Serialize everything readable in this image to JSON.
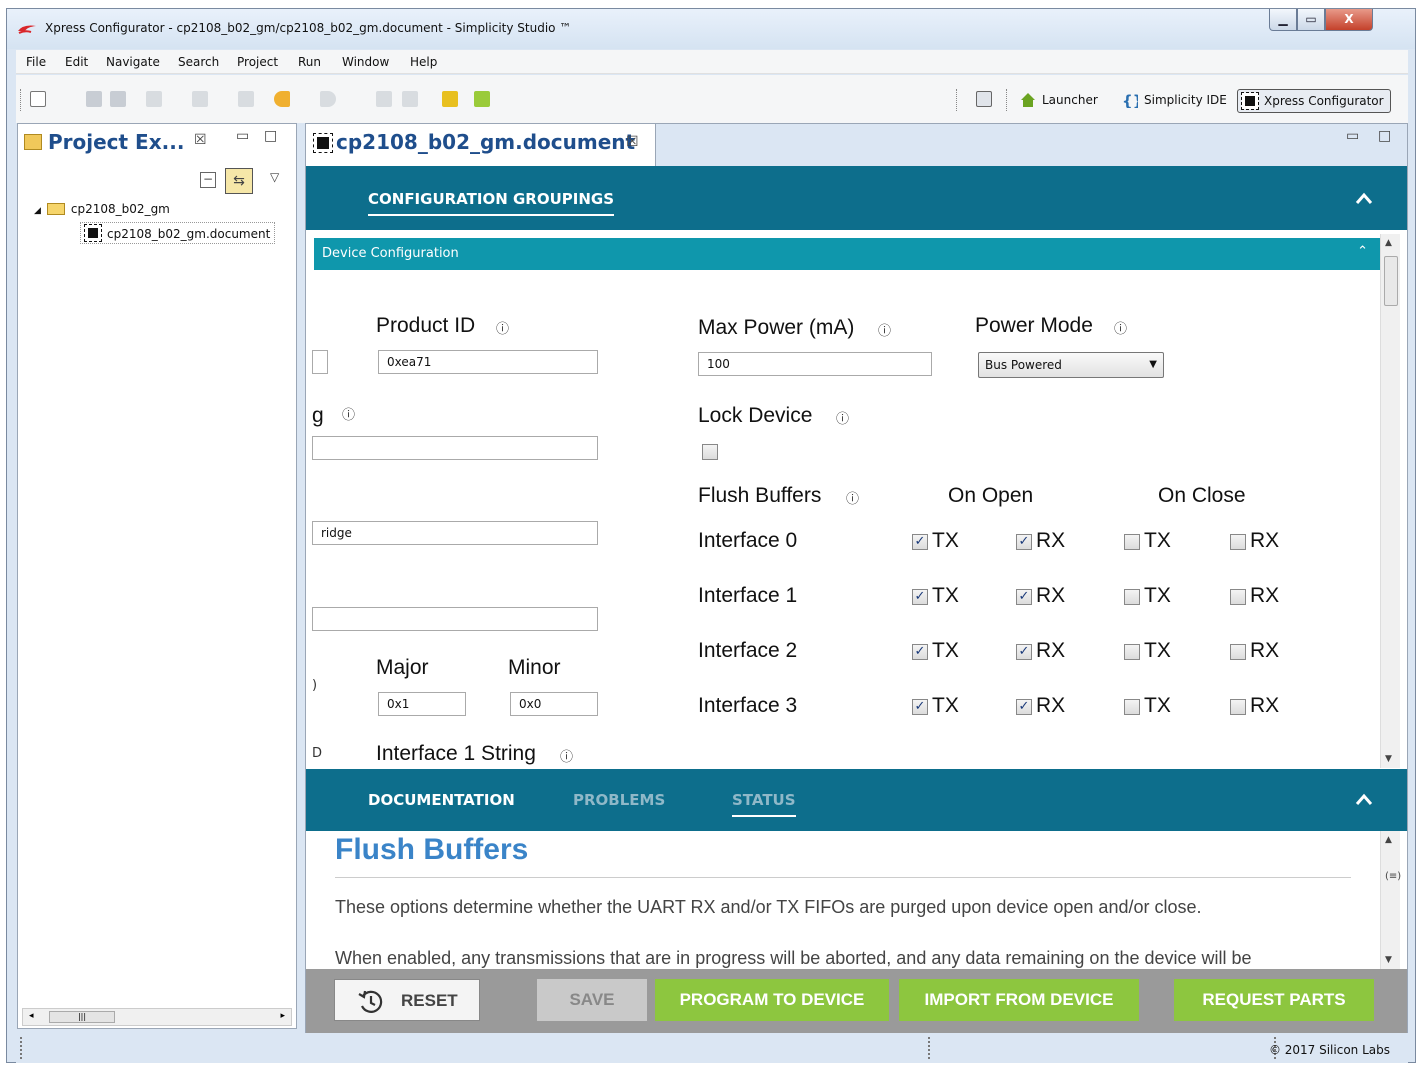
{
  "window": {
    "title": "Xpress Configurator - cp2108_b02_gm/cp2108_b02_gm.document - Simplicity Studio ™",
    "close_glyph": "X"
  },
  "menu": [
    "File",
    "Edit",
    "Navigate",
    "Search",
    "Project",
    "Run",
    "Window",
    "Help"
  ],
  "perspectives": {
    "launcher": "Launcher",
    "ide": "Simplicity IDE",
    "configurator": "Xpress Configurator"
  },
  "project_explorer": {
    "title": "Project Ex...",
    "tree": [
      {
        "label": "cp2108_b02_gm",
        "type": "folder"
      },
      {
        "label": "cp2108_b02_gm.document",
        "type": "document"
      }
    ]
  },
  "editor": {
    "tab_title": "cp2108_b02_gm.document",
    "groupings_tab": "CONFIGURATION GROUPINGS",
    "section_title": "Device Configuration",
    "fields": {
      "product_id_label": "Product ID",
      "product_id_value": "0xea71",
      "max_power_label": "Max Power (mA)",
      "max_power_value": "100",
      "power_mode_label": "Power Mode",
      "power_mode_value": "Bus Powered",
      "partial_string_label": "g",
      "lock_device_label": "Lock Device",
      "partial_bridge_value": "ridge",
      "major_label": "Major",
      "major_value": "0x1",
      "minor_label": "Minor",
      "minor_value": "0x0",
      "interface1_string_label": "Interface 1 String"
    },
    "flush": {
      "label": "Flush Buffers",
      "on_open": "On Open",
      "on_close": "On Close",
      "tx": "TX",
      "rx": "RX",
      "rows": [
        {
          "name": "Interface 0",
          "open_tx": true,
          "open_rx": true,
          "close_tx": false,
          "close_rx": false
        },
        {
          "name": "Interface 1",
          "open_tx": true,
          "open_rx": true,
          "close_tx": false,
          "close_rx": false
        },
        {
          "name": "Interface 2",
          "open_tx": true,
          "open_rx": true,
          "close_tx": false,
          "close_rx": false
        },
        {
          "name": "Interface 3",
          "open_tx": true,
          "open_rx": true,
          "close_tx": false,
          "close_rx": false
        }
      ]
    }
  },
  "bottom_tabs": {
    "documentation": "DOCUMENTATION",
    "problems": "PROBLEMS",
    "status": "STATUS"
  },
  "documentation": {
    "title": "Flush Buffers",
    "p1": "These options determine whether the UART RX and/or TX FIFOs are purged upon device open and/or close.",
    "p2": "When enabled, any transmissions that are in progress will be aborted, and any data remaining on the device will be"
  },
  "buttons": {
    "reset": "RESET",
    "save": "SAVE",
    "program": "PROGRAM TO DEVICE",
    "import": "IMPORT FROM DEVICE",
    "request": "REQUEST PARTS"
  },
  "status_bar": {
    "copyright": "© 2017 Silicon Labs"
  },
  "colors": {
    "teal": "#0d6e8c",
    "section_teal": "#0f97ac",
    "green_button": "#8dc63f",
    "doc_title": "#3a84c8"
  }
}
